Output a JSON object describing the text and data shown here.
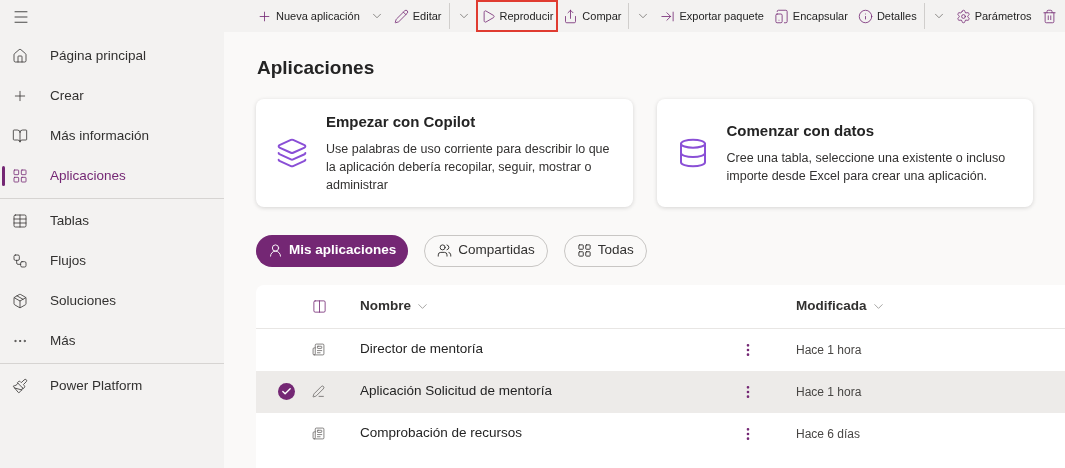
{
  "sidebar": {
    "groups": [
      {
        "items": [
          {
            "label": "Página principal",
            "selected": false
          },
          {
            "label": "Crear",
            "selected": false
          },
          {
            "label": "Más información",
            "selected": false
          },
          {
            "label": "Aplicaciones",
            "selected": true
          }
        ]
      },
      {
        "items": [
          {
            "label": "Tablas",
            "selected": false
          },
          {
            "label": "Flujos",
            "selected": false
          },
          {
            "label": "Soluciones",
            "selected": false
          },
          {
            "label": "Más",
            "selected": false
          }
        ]
      },
      {
        "items": [
          {
            "label": "Power Platform",
            "selected": false
          }
        ]
      }
    ]
  },
  "toolbar": [
    {
      "kind": "button",
      "label": "Nueva aplicación",
      "highlighted": false
    },
    {
      "kind": "chevron"
    },
    {
      "kind": "button",
      "label": "Editar",
      "highlighted": false
    },
    {
      "kind": "separator"
    },
    {
      "kind": "chevron"
    },
    {
      "kind": "button",
      "label": "Reproducir",
      "highlighted": true
    },
    {
      "kind": "button",
      "label": "Compar",
      "highlighted": false
    },
    {
      "kind": "separator"
    },
    {
      "kind": "chevron"
    },
    {
      "kind": "button",
      "label": "Exportar paquete",
      "highlighted": false
    },
    {
      "kind": "button",
      "label": "Encapsular",
      "highlighted": false
    },
    {
      "kind": "button",
      "label": "Detalles",
      "highlighted": false
    },
    {
      "kind": "separator"
    },
    {
      "kind": "chevron"
    },
    {
      "kind": "button",
      "label": "Parámetros",
      "highlighted": false
    },
    {
      "kind": "button",
      "highlighted": false
    }
  ],
  "page": {
    "title": "Aplicaciones",
    "cards": [
      {
        "title": "Empezar con Copilot",
        "text": "Use palabras de uso corriente para describir lo que la aplicación debería recopilar, seguir, mostrar o administrar"
      },
      {
        "title": "Comenzar con datos",
        "text": "Cree una tabla, seleccione una existente o incluso importe desde Excel para crear una aplicación."
      }
    ],
    "filters": [
      {
        "label": "Mis aplicaciones",
        "selected": true
      },
      {
        "label": "Compartidas",
        "selected": false
      },
      {
        "label": "Todas",
        "selected": false
      }
    ],
    "table": {
      "columns": [
        "Nombre",
        "Modificada"
      ],
      "rows": [
        {
          "kind": "model",
          "name": "Director de mentoría",
          "modified": "Hace 1 hora",
          "selected": false
        },
        {
          "kind": "canvas",
          "name": "Aplicación Solicitud de mentoría",
          "modified": "Hace 1 hora",
          "selected": true
        },
        {
          "kind": "model",
          "name": "Comprobación de recursos",
          "modified": "Hace 6 días",
          "selected": false
        }
      ]
    }
  }
}
